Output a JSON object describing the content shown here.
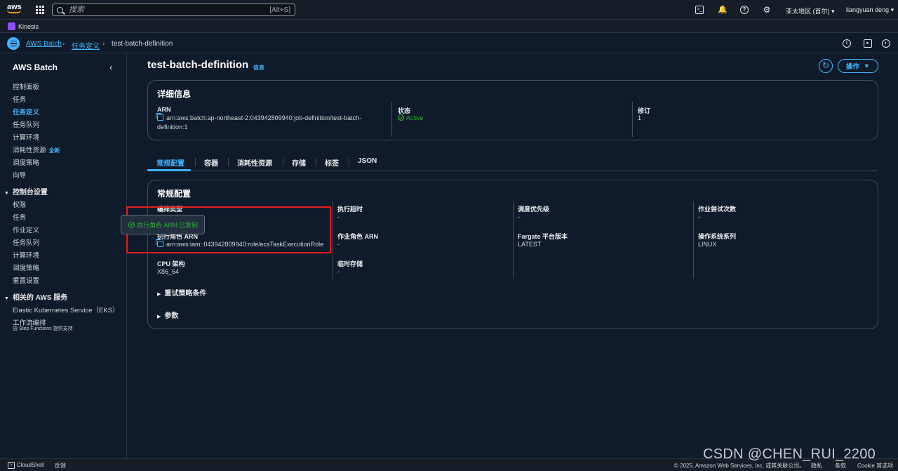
{
  "topbar": {
    "logo_text": "aws",
    "search_placeholder": "搜索",
    "search_shortcut": "[Alt+S]",
    "region": "亚太地区 (首尔)",
    "user": "liangyuan deng"
  },
  "favorites": {
    "kinesis": "Kinesis"
  },
  "breadcrumb": {
    "items": [
      "AWS Batch",
      "任务定义",
      "test-batch-definition"
    ]
  },
  "sidebar": {
    "title": "AWS Batch",
    "items": [
      "控制面板",
      "任务",
      "任务定义",
      "任务队列",
      "计算环境",
      "消耗性资源",
      "调度策略",
      "向导"
    ],
    "new_badge": "全新",
    "console_settings_title": "控制台设置",
    "console_items": [
      "权限",
      "任务",
      "作业定义",
      "任务队列",
      "计算环境",
      "调度策略",
      "重置设置"
    ],
    "related_title": "相关的 AWS 服务",
    "related_items": [
      "Elastic Kubernetes Service（EKS）",
      "工作流编排"
    ],
    "related_sub": "由 Step Functions 提供支持"
  },
  "page": {
    "title": "test-batch-definition",
    "info": "信息",
    "actions": "操作"
  },
  "details": {
    "title": "详细信息",
    "arn_label": "ARN",
    "arn_line1": "arn:aws:batch:ap-northeast-2:043942809940:job-definition/test-batch-",
    "arn_line2": "definition:1",
    "status_label": "状态",
    "status_value": "Active",
    "revision_label": "修订",
    "revision_value": "1"
  },
  "tabs": [
    "常规配置",
    "容器",
    "消耗性资源",
    "存储",
    "标签",
    "JSON"
  ],
  "general": {
    "title": "常规配置",
    "orchestration_label": "编排类型",
    "exec_role_label": "执行角色 ARN",
    "exec_role_value": "arn:aws:iam::043942809940:role/ecsTaskExecutionRole",
    "cpu_label": "CPU 架构",
    "cpu_value": "X86_64",
    "timeout_label": "执行超时",
    "timeout_value": "-",
    "job_role_label": "作业角色 ARN",
    "job_role_value": "-",
    "ephemeral_label": "临时存储",
    "ephemeral_value": "-",
    "priority_label": "调度优先级",
    "priority_value": "-",
    "fargate_label": "Fargate 平台版本",
    "fargate_value": "LATEST",
    "attempts_label": "作业尝试次数",
    "attempts_value": "-",
    "os_label": "操作系统系列",
    "os_value": "LINUX",
    "retry_expander": "重试策略条件",
    "params_expander": "参数"
  },
  "toast": {
    "message": "执行角色 ARN 已复制"
  },
  "footer": {
    "cloudshell": "CloudShell",
    "feedback": "反馈",
    "copyright": "© 2025, Amazon Web Services, Inc. 或其关联公司。",
    "privacy": "隐私",
    "terms": "条款",
    "cookies": "Cookie 首选项"
  },
  "watermark": "CSDN @CHEN_RUI_2200",
  "colors": {
    "accent": "#42b4ff",
    "success": "#29ad32",
    "highlight": "#e01f1f",
    "background": "#0f1b2a"
  }
}
